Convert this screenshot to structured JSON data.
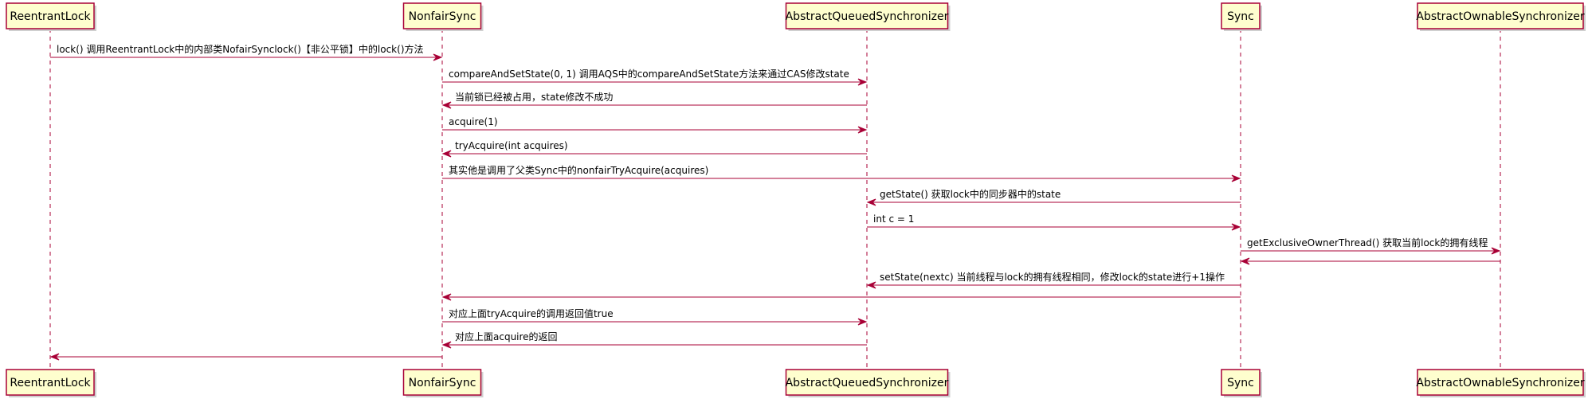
{
  "participants": [
    {
      "id": "rl",
      "name": "ReentrantLock"
    },
    {
      "id": "ns",
      "name": "NonfairSync"
    },
    {
      "id": "aqs",
      "name": "AbstractQueuedSynchronizer"
    },
    {
      "id": "sync",
      "name": "Sync"
    },
    {
      "id": "aos",
      "name": "AbstractOwnableSynchronizer"
    }
  ],
  "messages": [
    {
      "from": "rl",
      "to": "ns",
      "label": "lock() 调用ReentrantLock中的内部类NofairSynclock()【非公平锁】中的lock()方法"
    },
    {
      "from": "ns",
      "to": "aqs",
      "label": "compareAndSetState(0, 1) 调用AQS中的compareAndSetState方法来通过CAS修改state"
    },
    {
      "from": "aqs",
      "to": "ns",
      "label": "当前锁已经被占用，state修改不成功"
    },
    {
      "from": "ns",
      "to": "aqs",
      "label": "acquire(1)"
    },
    {
      "from": "aqs",
      "to": "ns",
      "label": "tryAcquire(int acquires)"
    },
    {
      "from": "ns",
      "to": "sync",
      "label": "其实他是调用了父类Sync中的nonfairTryAcquire(acquires)"
    },
    {
      "from": "sync",
      "to": "aqs",
      "label": "getState() 获取lock中的同步器中的state"
    },
    {
      "from": "aqs",
      "to": "sync",
      "label": "int c = 1"
    },
    {
      "from": "sync",
      "to": "aos",
      "label": "getExclusiveOwnerThread() 获取当前lock的拥有线程"
    },
    {
      "from": "aos",
      "to": "sync",
      "label": ""
    },
    {
      "from": "sync",
      "to": "aqs",
      "label": "setState(nextc) 当前线程与lock的拥有线程相同，修改lock的state进行+1操作"
    },
    {
      "from": "sync",
      "to": "ns",
      "label": ""
    },
    {
      "from": "ns",
      "to": "aqs",
      "label": "对应上面tryAcquire的调用返回值true"
    },
    {
      "from": "aqs",
      "to": "ns",
      "label": "对应上面acquire的返回"
    },
    {
      "from": "ns",
      "to": "rl",
      "label": ""
    }
  ]
}
